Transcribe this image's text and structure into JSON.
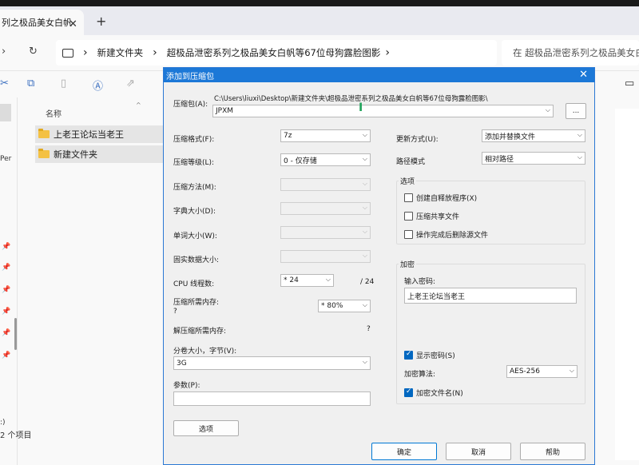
{
  "explorer": {
    "tab_title": "列之极品美女白帆",
    "tab_close": "✕",
    "tab_add": "+",
    "address": [
      "新建文件夹",
      "超极品泄密系列之极品美女白帆等67位母狗露脸图影"
    ],
    "search_placeholder": "在 超极品泄密系列之极品美女白帆",
    "column_name": "名称",
    "rows": [
      "上老王论坛当老王",
      "新建文件夹"
    ],
    "status_items": "2 个项目",
    "left_text_1": "Per",
    "left_text_2": ":)"
  },
  "dialog": {
    "title": "添加到压缩包",
    "archive_label": "压缩包(A):",
    "archive_path": "C:\\Users\\liuxi\\Desktop\\新建文件夹\\超极品泄密系列之极品美女白帆等67位母狗露脸图影\\",
    "archive_name": "JPXM",
    "browse_label": "...",
    "format_label": "压缩格式(F):",
    "format_value": "7z",
    "level_label": "压缩等级(L):",
    "level_value": "0 - 仅存储",
    "method_label": "压缩方法(M):",
    "dict_label": "字典大小(D):",
    "word_label": "单词大小(W):",
    "solid_label": "固实数据大小:",
    "cpu_label": "CPU 线程数:",
    "cpu_value": "* 24",
    "cpu_total": "/ 24",
    "mem_comp_label": "压缩所需内存:",
    "mem_comp_q": "?",
    "mem_comp_value": "* 80%",
    "mem_decomp_label": "解压缩所需内存:",
    "mem_decomp_value": "?",
    "volume_label": "分卷大小，字节(V):",
    "volume_value": "3G",
    "params_label": "参数(P):",
    "options_button": "选项",
    "update_label": "更新方式(U):",
    "update_value": "添加并替换文件",
    "path_mode_label": "路径模式",
    "path_mode_value": "相对路径",
    "options_group": "选项",
    "opt_sfx": "创建自释放程序(X)",
    "opt_shared": "压缩共享文件",
    "opt_delete": "操作完成后删除源文件",
    "encrypt_group": "加密",
    "password_label": "输入密码:",
    "password_value": "上老王论坛当老王",
    "show_password": "显示密码(S)",
    "enc_method_label": "加密算法:",
    "enc_method_value": "AES-256",
    "enc_names": "加密文件名(N)",
    "ok": "确定",
    "cancel": "取消",
    "help": "帮助"
  }
}
